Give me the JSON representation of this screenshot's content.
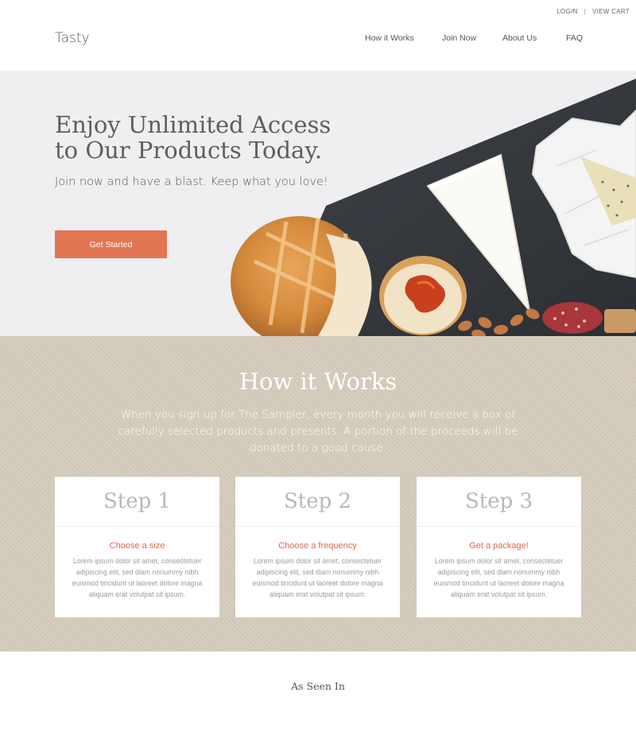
{
  "utility": {
    "login": "LOGIN",
    "separator": "|",
    "view_cart": "VIEW CART"
  },
  "header": {
    "logo": "Tasty",
    "nav": [
      "How it Works",
      "Join Now",
      "About Us",
      "FAQ"
    ]
  },
  "hero": {
    "title": "Enjoy Unlimited Access to Our Products Today.",
    "subtitle": "Join now and have a blast. Keep what you love!",
    "cta": "Get Started",
    "image_icon": "food-board-image"
  },
  "how_it_works": {
    "title": "How it Works",
    "description": "When you sign up for The Sampler, every month you will receive a box of carefully selected products and presents. A portion of the proceeds will be donated to a good cause.",
    "steps": [
      {
        "heading": "Step 1",
        "title": "Choose a size",
        "body": "Lorem ipsum dolor sit amet, consectetuer adipiscing elit, sed diam nonummy nibh euismod tincidunt ut laoreet dolore magna aliquam erat volutpat sit ipsum."
      },
      {
        "heading": "Step 2",
        "title": "Choose a frequency",
        "body": "Lorem ipsum dolor sit amet, consectetuer adipiscing elit, sed diam nonummy nibh euismod tincidunt ut laoreet dolore magna aliquam erat volutpat sit ipsum."
      },
      {
        "heading": "Step 3",
        "title": "Get a package!",
        "body": "Lorem ipsum dolor sit amet, consectetuer adipiscing elit, sed diam nonummy nibh euismod tincidunt ut laoreet dolore magna aliquam erat volutpat sit ipsum."
      }
    ]
  },
  "as_seen_in": {
    "title": "As Seen In"
  },
  "colors": {
    "accent": "#e27552",
    "section_bg": "#d4cbbc",
    "hero_bg": "#efeff1"
  }
}
